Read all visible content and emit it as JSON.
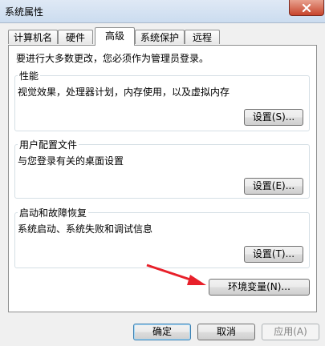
{
  "window": {
    "title": "系统属性"
  },
  "tabs": [
    {
      "label": "计算机名"
    },
    {
      "label": "硬件"
    },
    {
      "label": "高级",
      "active": true
    },
    {
      "label": "系统保护"
    },
    {
      "label": "远程"
    }
  ],
  "intro_text": "要进行大多数更改，您必须作为管理员登录。",
  "performance": {
    "title": "性能",
    "description": "视觉效果，处理器计划，内存使用，以及虚拟内存",
    "button_label": "设置(S)..."
  },
  "user_profiles": {
    "title": "用户配置文件",
    "description": "与您登录有关的桌面设置",
    "button_label": "设置(E)..."
  },
  "startup_recovery": {
    "title": "启动和故障恢复",
    "description": "系统启动、系统失败和调试信息",
    "button_label": "设置(T)..."
  },
  "env_button_label": "环境变量(N)...",
  "footer": {
    "ok_label": "确定",
    "cancel_label": "取消",
    "apply_label": "应用(A)"
  },
  "icons": {
    "close": "close-icon"
  }
}
